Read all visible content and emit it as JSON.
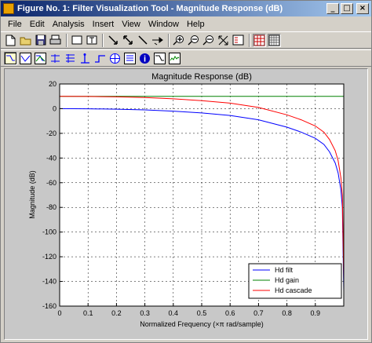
{
  "window": {
    "title": "Figure No. 1: Filter Visualization Tool - Magnitude Response (dB)",
    "minimize_glyph": "_",
    "maximize_glyph": "□",
    "close_glyph": "×"
  },
  "menubar": {
    "items": [
      "File",
      "Edit",
      "Analysis",
      "Insert",
      "View",
      "Window",
      "Help"
    ]
  },
  "toolbar1": {
    "icons": [
      "new-file-icon",
      "open-folder-icon",
      "save-icon",
      "print-icon",
      "insert-rectangle-icon",
      "insert-text-icon",
      "insert-arrow-icon",
      "insert-arrow-icon-2",
      "insert-line-icon",
      "rotate-3d-icon",
      "zoom-in-icon",
      "zoom-out-icon",
      "zoom-x-icon",
      "full-view-icon",
      "legend-icon",
      "grid-icon"
    ]
  },
  "toolbar2": {
    "icons": [
      "magnitude-response-icon",
      "phase-response-icon",
      "magnitude-phase-icon",
      "group-delay-icon",
      "phase-delay-icon",
      "impulse-response-icon",
      "step-response-icon",
      "pole-zero-icon",
      "filter-coefficients-icon",
      "filter-info-icon",
      "magnitude-estimate-icon",
      "noise-power-icon"
    ]
  },
  "chart_data": {
    "type": "line",
    "title": "Magnitude Response (dB)",
    "xlabel": "Normalized Frequency (×π rad/sample)",
    "ylabel": "Magnitude (dB)",
    "xlim": [
      0,
      1
    ],
    "ylim": [
      -160,
      20
    ],
    "xticks": [
      0,
      0.1,
      0.2,
      0.3,
      0.4,
      0.5,
      0.6,
      0.7,
      0.8,
      0.9
    ],
    "xtick_labels": [
      "0",
      "0.1",
      "0.2",
      "0.3",
      "0.4",
      "0.5",
      "0.6",
      "0.7",
      "0.8",
      "0.9"
    ],
    "yticks": [
      20,
      0,
      -20,
      -40,
      -60,
      -80,
      -100,
      -120,
      -140,
      -160
    ],
    "ytick_labels": [
      "20",
      "0",
      "-20",
      "-40",
      "-60",
      "-80",
      "-100",
      "-120",
      "-140",
      "-160"
    ],
    "grid": true,
    "legend_position": "bottom-right",
    "series": [
      {
        "name": "Hd filt",
        "color": "#0000ff",
        "x": [
          0,
          0.1,
          0.2,
          0.3,
          0.4,
          0.5,
          0.6,
          0.7,
          0.8,
          0.85,
          0.9,
          0.93,
          0.95,
          0.97,
          0.98,
          0.99,
          0.995,
          1.0
        ],
        "y": [
          0,
          -0.1,
          -0.4,
          -1,
          -2,
          -3.5,
          -5.5,
          -9,
          -15,
          -19,
          -24,
          -29,
          -35,
          -44,
          -52,
          -66,
          -80,
          -148
        ]
      },
      {
        "name": "Hd gain",
        "color": "#008000",
        "x": [
          0,
          1
        ],
        "y": [
          10,
          10
        ]
      },
      {
        "name": "Hd cascade",
        "color": "#ff0000",
        "x": [
          0,
          0.1,
          0.2,
          0.3,
          0.4,
          0.5,
          0.6,
          0.7,
          0.8,
          0.85,
          0.9,
          0.93,
          0.95,
          0.97,
          0.98,
          0.99,
          0.995,
          1.0
        ],
        "y": [
          10,
          9.9,
          9.6,
          9,
          8,
          6.5,
          4.5,
          1,
          -5,
          -9,
          -14,
          -19,
          -25,
          -34,
          -42,
          -56,
          -70,
          -138
        ]
      }
    ]
  }
}
